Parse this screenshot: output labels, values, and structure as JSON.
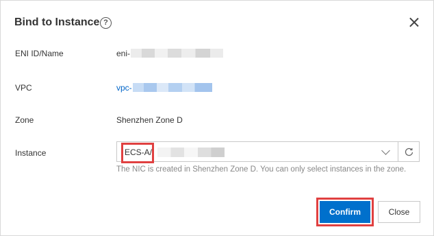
{
  "dialog": {
    "title": "Bind to Instance",
    "help_icon_glyph": "?",
    "close_icon": "close-icon"
  },
  "fields": {
    "eni": {
      "label": "ENI ID/Name",
      "value": "eni-"
    },
    "vpc": {
      "label": "VPC",
      "value": "vpc-"
    },
    "zone": {
      "label": "Zone",
      "value": "Shenzhen Zone D"
    },
    "instance": {
      "label": "Instance",
      "selected": "ECS-A/",
      "hint": "The NIC is created in Shenzhen Zone D. You can only select instances in the zone."
    }
  },
  "buttons": {
    "confirm": "Confirm",
    "close": "Close"
  },
  "colors": {
    "primary": "#0070cc",
    "link": "#0064c8",
    "highlight": "#e04040"
  }
}
